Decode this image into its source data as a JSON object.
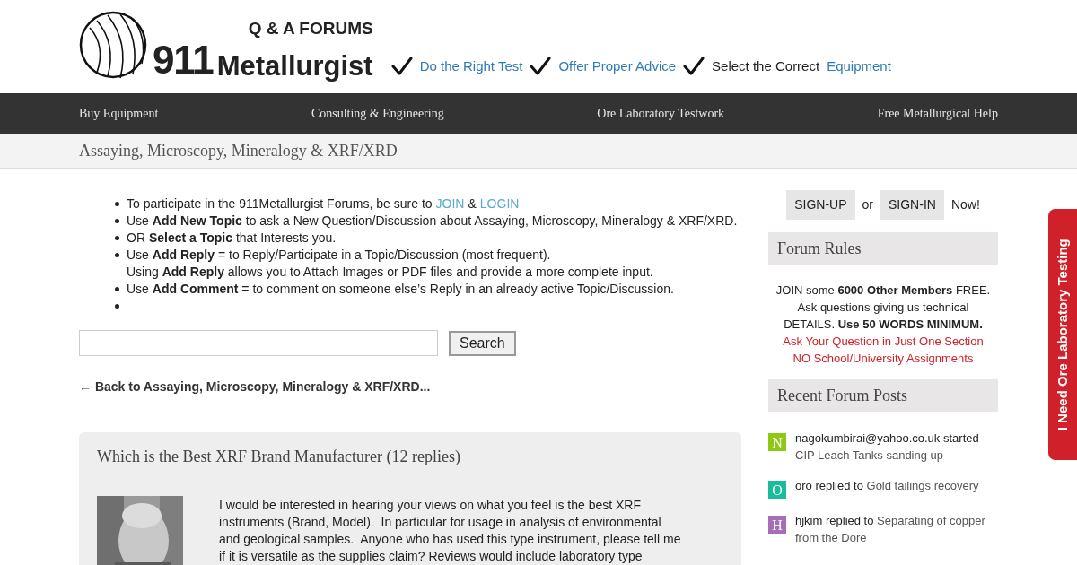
{
  "header": {
    "logo": {
      "tagline": "Q & A FORUMS",
      "number": "911",
      "name": "Metallurgist"
    },
    "slogans": [
      {
        "link": "Do the Right Test"
      },
      {
        "link": "Offer Proper Advice"
      },
      {
        "prefix": "Select the Correct",
        "link": "Equipment"
      }
    ]
  },
  "nav": [
    "Buy Equipment",
    "Consulting & Engineering",
    "Ore Laboratory Testwork",
    "Free Metallurgical Help"
  ],
  "breadcrumb": "Assaying, Microscopy, Mineralogy & XRF/XRD",
  "instructions": [
    {
      "kind": "links",
      "text": "To participate in the 911Metallurgist Forums, be sure to",
      "links": [
        "JOIN",
        "LOGIN"
      ],
      "joiner": "&"
    },
    {
      "kind": "text",
      "lines": [
        "Use **Add New Topic** to ask a New Question/Discussion about Assaying, Microscopy, Mineralogy & XRF/XRD."
      ]
    },
    {
      "kind": "text",
      "lines": [
        "OR **Select a Topic** that Interests you."
      ]
    },
    {
      "kind": "text",
      "lines": [
        "Use **Add Reply** = to Reply/Participate in a Topic/Discussion (most frequent).",
        "Using **Add Reply** allows you to Attach Images or PDF files and provide a more complete input."
      ]
    },
    {
      "kind": "text",
      "lines": [
        "Use **Add Comment** = to comment on someone else’s Reply in an already active Topic/Discussion."
      ]
    },
    {
      "kind": "empty"
    }
  ],
  "search": {
    "button": "Search"
  },
  "back_link": "← Back to Assaying, Microscopy, Mineralogy & XRF/XRD...",
  "topic": {
    "title": "Which is the Best XRF Brand Manufacturer (12 replies)",
    "body": [
      "I would be interested in hearing your views on what you feel is the best XRF",
      "instruments (Brand, Model).  In particular for usage in analysis of environmental",
      "and geological samples.  Anyone who has used this type instrument, please tell me",
      "if it is versatile as the supplies claim? Reviews would include laboratory type"
    ]
  },
  "sidebar": {
    "auth": {
      "signup": "SIGN-UP",
      "or": "or",
      "signin": "SIGN-IN",
      "suffix": "Now!"
    },
    "rules_title": "Forum Rules",
    "rules": [
      {
        "kind": "normal",
        "text": "JOIN some **6000 Other Members** FREE. Ask questions giving us technical DETAILS. **Use 50 WORDS MINIMUM.**"
      },
      {
        "kind": "alert",
        "text": "Ask Your Question in Just One Section"
      },
      {
        "kind": "alert",
        "text": "NO School/University Assignments"
      }
    ],
    "recent_title": "Recent Forum Posts",
    "recent": [
      {
        "letter": "N",
        "color": "#8cc814",
        "user": "nagokumbirai@yahoo.co.uk",
        "action": "started",
        "topic": "CIP Leach Tanks sanding up"
      },
      {
        "letter": "O",
        "color": "#1abc9c",
        "user": "oro",
        "action": "replied to",
        "topic": "Gold tailings recovery"
      },
      {
        "letter": "H",
        "color": "#a56fb5",
        "user": "hjkim",
        "action": "replied to",
        "topic": "Separating of copper from the Dore"
      }
    ]
  },
  "side_tab": "I Need Ore Laboratory Testing"
}
